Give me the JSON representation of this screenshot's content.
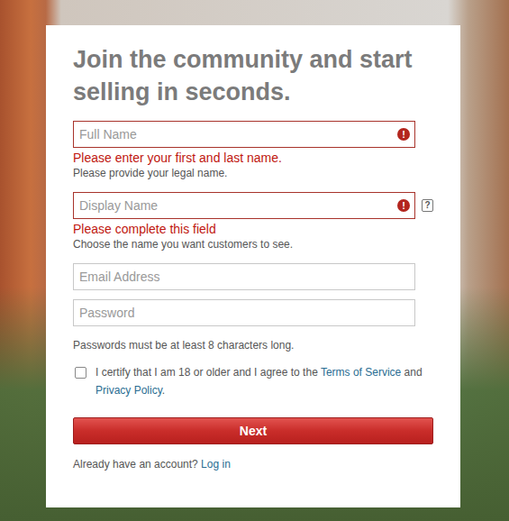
{
  "heading": "Join the community and start selling in seconds.",
  "fields": [
    {
      "kind": "text",
      "placeholder": "Full Name",
      "invalid": true,
      "error_icon": "!",
      "error": "Please enter your first and last name.",
      "help": "Please provide your legal name."
    },
    {
      "kind": "text",
      "placeholder": "Display Name",
      "invalid": true,
      "error_icon": "!",
      "help_icon": "?",
      "error": "Please complete this field",
      "help": "Choose the name you want customers to see."
    },
    {
      "kind": "email",
      "placeholder": "Email Address",
      "invalid": false
    },
    {
      "kind": "password",
      "placeholder": "Password",
      "invalid": false
    }
  ],
  "password_hint": "Passwords must be at least 8 characters long.",
  "agreement": {
    "checked": false,
    "parts": [
      {
        "text": "I certify that I am 18 or older and I agree to the ",
        "link": false
      },
      {
        "text": "Terms of Service",
        "link": true
      },
      {
        "text": " and ",
        "link": false
      },
      {
        "text": "Privacy Policy",
        "link": true
      },
      {
        "text": ".",
        "link": false
      }
    ]
  },
  "button": "Next",
  "footer": {
    "text": "Already have an account? ",
    "link": "Log in"
  }
}
